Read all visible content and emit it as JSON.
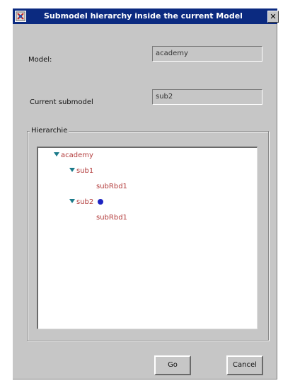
{
  "window": {
    "title": "Submodel hierarchy inside the current Model",
    "close_glyph": "✕"
  },
  "model": {
    "label": "Model:",
    "value": "academy"
  },
  "submodel": {
    "label": "Current submodel",
    "value": "sub2"
  },
  "hierarchy": {
    "label": "Hierarchie",
    "nodes": [
      {
        "label": "academy",
        "level": 0,
        "expanded": true
      },
      {
        "label": "sub1",
        "level": 1,
        "expanded": true
      },
      {
        "label": "subRbd1",
        "level": 2,
        "expanded": false
      },
      {
        "label": "sub2",
        "level": 1,
        "expanded": true,
        "current": true
      },
      {
        "label": "subRbd1",
        "level": 2,
        "expanded": false
      }
    ],
    "colors": {
      "node_text": "#b23a3a",
      "toggle": "#1b7a8a",
      "current_marker": "#1d24c2"
    }
  },
  "buttons": {
    "go": "Go",
    "cancel": "Cancel"
  },
  "colors": {
    "titlebar": "#0b2a80",
    "dialog_bg": "#c6c6c6"
  }
}
